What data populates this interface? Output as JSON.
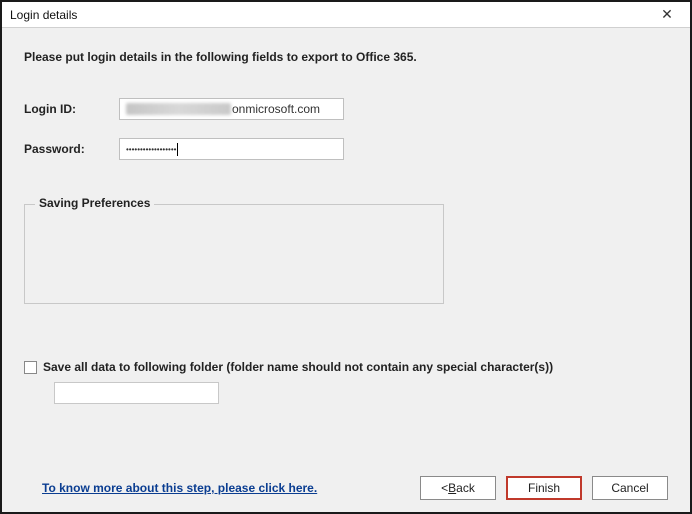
{
  "titlebar": {
    "title": "Login details"
  },
  "instruction": "Please put login details in the following fields to export to Office 365.",
  "fields": {
    "login_label": "Login ID:",
    "login_suffix": "onmicrosoft.com",
    "password_label": "Password:",
    "password_mask": "••••••••••••••••••"
  },
  "prefs": {
    "legend": "Saving Preferences"
  },
  "save_folder": {
    "label": "Save all data to following folder (folder name should not contain any special character(s))"
  },
  "footer": {
    "help_link": "To know more about this step, please click here.",
    "back": "ack",
    "back_prefix": "< ",
    "finish": "Finish",
    "cancel": "Cancel"
  }
}
